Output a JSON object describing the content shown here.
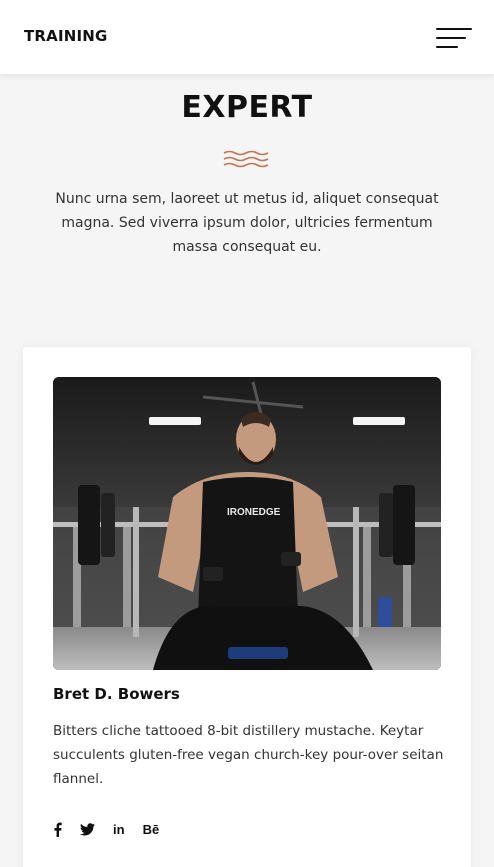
{
  "header": {
    "brand": "TRAINING",
    "menu_icon": "hamburger-menu-icon"
  },
  "section": {
    "title": "EXPERT",
    "divider_icon": "wave-divider-icon",
    "intro": "Nunc urna sem, laoreet ut metus id, aliquet consequat magna. Sed viverra ipsum dolor, ultricies fermentum massa consequat eu."
  },
  "trainer": {
    "photo_alt": "Trainer photo",
    "shirt_print": "IRONEDGE",
    "name": "Bret D. Bowers",
    "bio": "Bitters cliche tattooed 8-bit distillery mustache. Keytar succulents gluten-free vegan church-key pour-over seitan flannel.",
    "social": [
      {
        "icon": "facebook-icon",
        "label": "f"
      },
      {
        "icon": "twitter-icon",
        "label": ""
      },
      {
        "icon": "linkedin-icon",
        "label": "in"
      },
      {
        "icon": "behance-icon",
        "label": "Bē"
      }
    ]
  },
  "colors": {
    "accent": "#c9704f",
    "text": "#111111",
    "muted": "#333333",
    "background": "#f5f5f5",
    "card": "#ffffff"
  }
}
